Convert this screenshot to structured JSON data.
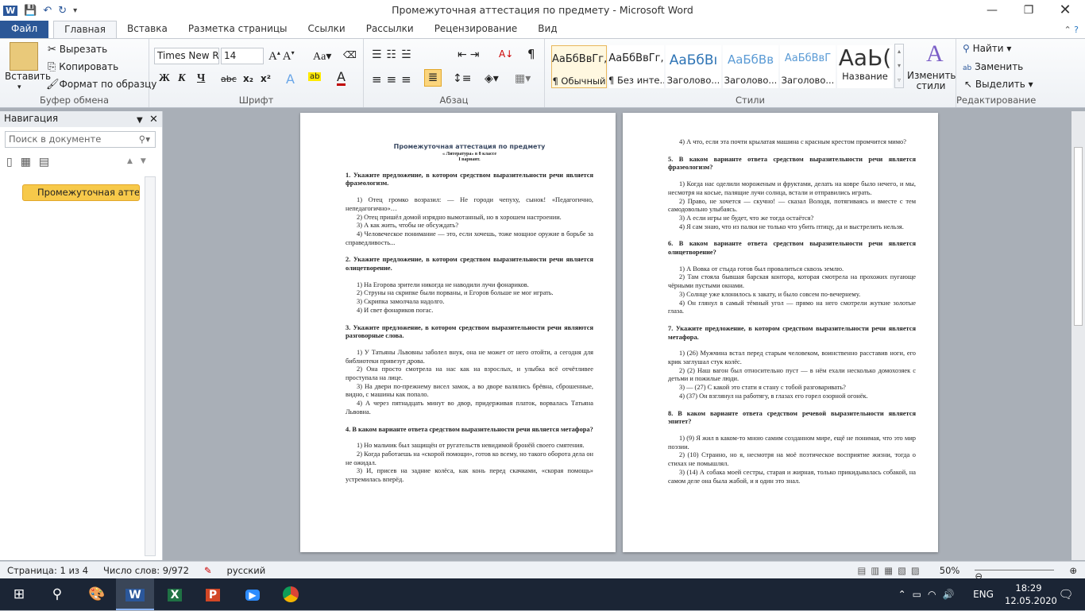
{
  "window": {
    "title": "Промежуточная аттестация по предмету  -  Microsoft Word"
  },
  "tabs": [
    "Файл",
    "Главная",
    "Вставка",
    "Разметка страницы",
    "Ссылки",
    "Рассылки",
    "Рецензирование",
    "Вид"
  ],
  "ribbon": {
    "clipboard": {
      "paste": "Вставить",
      "cut": "Вырезать",
      "copy": "Копировать",
      "format": "Формат по образцу",
      "label": "Буфер обмена"
    },
    "font": {
      "name": "Times New Ro",
      "size": "14",
      "bold": "Ж",
      "italic": "К",
      "underline": "Ч",
      "label": "Шрифт"
    },
    "paragraph": {
      "label": "Абзац"
    },
    "styles": {
      "items": [
        {
          "sample": "АаБбВвГг,",
          "name": "¶ Обычный"
        },
        {
          "sample": "АаБбВвГг,",
          "name": "¶ Без инте..."
        },
        {
          "sample": "АаБбВı",
          "name": "Заголово..."
        },
        {
          "sample": "АаБбВв",
          "name": "Заголово..."
        },
        {
          "sample": "АаБбВвГ",
          "name": "Заголово..."
        },
        {
          "sample": "АаЬ(",
          "name": "Название"
        }
      ],
      "change": "Изменить стили",
      "label": "Стили"
    },
    "editing": {
      "find": "Найти",
      "replace": "Заменить",
      "select": "Выделить",
      "label": "Редактирование"
    }
  },
  "nav": {
    "title": "Навигация",
    "search_placeholder": "Поиск в документе",
    "heading": "Промежуточная аттес..."
  },
  "doc": {
    "title": "Промежуточная аттестация по предмету",
    "subtitle1": "« Литература»  в 8 классе",
    "subtitle2": "I вариант.",
    "left": [
      {
        "t": "q",
        "x": "1. Укажите предложение, в котором средством выразительности речи является фразеологизм."
      },
      {
        "t": "it",
        "x": "1) Отец громко возразил: — Не городи чепуху, сынок! «Педагогично, непедагогично»…"
      },
      {
        "t": "it",
        "x": "2) Отец пришёл домой изрядно вымотанный, но в хорошем настроении."
      },
      {
        "t": "it",
        "x": "3) А как жить, чтобы не обсуждать?"
      },
      {
        "t": "it",
        "x": "4) Человеческое понимание — это, если хочешь, тоже мощное оружие в борьбе за справедливость..."
      },
      {
        "t": "q",
        "x": "2. Укажите предложение, в котором средством выразительности речи является олицетворение."
      },
      {
        "t": "it",
        "x": "1) На Егорова зрители никогда не наводили лучи фонариков."
      },
      {
        "t": "it",
        "x": "2) Струны на скрипке были порваны, и Егоров больше не мог играть."
      },
      {
        "t": "it",
        "x": "3) Скрипка замолчала надолго."
      },
      {
        "t": "it",
        "x": "4) И свет фонариков погас."
      },
      {
        "t": "q",
        "x": "3. Укажите предложение, в котором средством выразительности речи являются разговорные слова."
      },
      {
        "t": "it",
        "x": "1) У Татьяны Львовны заболел внук, она не может от него отойти, а сегодня для библиотеки привезут дрова."
      },
      {
        "t": "it",
        "x": "2) Она просто смотрела на нас как на взрослых, и улыбка всё отчётливее проступала на лице."
      },
      {
        "t": "it",
        "x": "3) На двери по-прежнему висел замок, а во дворе валялись брёвна, сброшенные, видно, с машины как попало."
      },
      {
        "t": "it",
        "x": "4) А через пятнадцать минут во двор, придерживая платок, ворвалась Татьяна Львовна."
      },
      {
        "t": "q",
        "x": "4. В каком варианте ответа средством выразительности речи является метафора?"
      },
      {
        "t": "it",
        "x": "1) Но мальчик был защищён от ругательств невидимой бронёй своего смятения."
      },
      {
        "t": "it",
        "x": "2) Когда работаешь на «скорой помощи», готов ко всему, но такого оборота дела он не ожидал."
      },
      {
        "t": "it",
        "x": "3) И, присев на задние колёса, как конь перед скачками, «скорая помощь» устремилась вперёд."
      }
    ],
    "right": [
      {
        "t": "it",
        "x": "4) А что, если эта почти крылатая машина с красным крестом промчится мимо?"
      },
      {
        "t": "q",
        "x": "5. В каком варианте ответа средством выразительности речи является фразеологизм?"
      },
      {
        "t": "it",
        "x": "1) Когда нас оделили мороженым и фруктами, делать на ковре было нечего, и мы, несмотря на косые, палящие лучи солнца, встали и отправились играть."
      },
      {
        "t": "it",
        "x": "2) Право, не хочется — скучно! — сказал Володя, потягиваясь и вместе с тем самодовольно улыбаясь."
      },
      {
        "t": "it",
        "x": "3) А если игры не будет, что же тогда остаётся?"
      },
      {
        "t": "it",
        "x": "4) Я сам знаю, что из палки не только что убить птицу, да и выстрелить нельзя."
      },
      {
        "t": "q",
        "x": "6. В каком варианте ответа средством выразительности речи является олицетворение?"
      },
      {
        "t": "it",
        "x": "1) А Вовка от стыда готов был провалиться сквозь землю."
      },
      {
        "t": "it",
        "x": "2) Там стояла бывшая барская контора, которая смотрела на прохожих пугающе чёрными пустыми окнами."
      },
      {
        "t": "it",
        "x": "3) Солнце уже клонилось к закату, и было совсем по-вечернему."
      },
      {
        "t": "it",
        "x": "4) Он глянул в самый тёмный угол — прямо на него смотрели жуткие золотые глаза."
      },
      {
        "t": "q",
        "x": "7. Укажите предложение, в котором средством выразительности речи является метафора."
      },
      {
        "t": "it",
        "x": "1) (26) Мужчина встал перед старым человеком, воинственно расставив ноги, его крик заглушал стук колёс."
      },
      {
        "t": "it",
        "x": "2) (2) Наш вагон был относительно пуст — в нём ехали несколько домохозяек с детьми и пожилые люди."
      },
      {
        "t": "it",
        "x": "3) — (27) С какой это стати я стану с тобой разговаривать?"
      },
      {
        "t": "it",
        "x": "4) (37) Он взглянул на работягу, в глазах его горел озорной огонёк."
      },
      {
        "t": "q",
        "x": "8. В каком варианте ответа средством речевой выразительности является эпитет?"
      },
      {
        "t": "it",
        "x": "1) (9) Я жил в каком-то мною самим созданном мире, ещё не понимая, что это мир поэзии."
      },
      {
        "t": "it",
        "x": "2) (10) Странно, но я, несмотря на моё поэтическое восприятие жизни, тогда о стихах не помышлял."
      },
      {
        "t": "it",
        "x": "3) (14) А собака моей сестры, старая и жирная, только прикидывалась собакой, на самом деле она была жабой, и я один это знал."
      }
    ]
  },
  "status": {
    "page": "Страница: 1 из 4",
    "words": "Число слов: 9/972",
    "lang": "русский",
    "zoom": "50%"
  },
  "taskbar": {
    "lang": "ENG",
    "time": "18:29",
    "date": "12.05.2020"
  },
  "colors": {
    "file_tab": "#2b5797",
    "taskbar": "#1b2535",
    "nav_heading": "#f7c94a"
  }
}
